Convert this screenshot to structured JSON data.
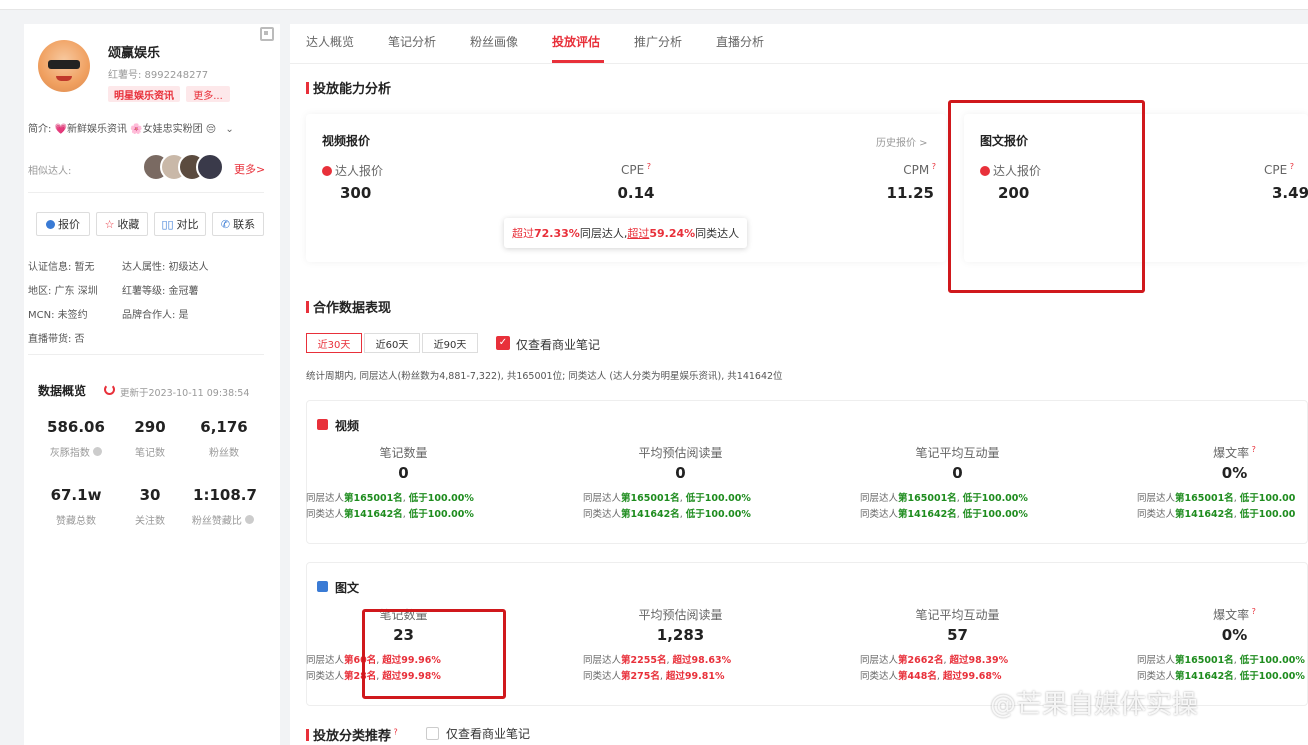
{
  "profile": {
    "name": "颂赢娱乐",
    "id_text": "红薯号: 8992248277",
    "tag": "明星娱乐资讯",
    "more_tag": "更多...",
    "bio": "简介: 💗新鲜娱乐资讯 🌸女娃忠实粉团 😔",
    "similar_label": "相似达人:",
    "similar_more": "更多>",
    "buttons": {
      "quote": "报价",
      "collect": "收藏",
      "compare": "对比",
      "contact": "联系"
    },
    "info": [
      {
        "left": "认证信息: 暂无",
        "right": "达人属性: 初级达人"
      },
      {
        "left": "地区: 广东 深圳",
        "right": "红薯等级: 金冠薯"
      },
      {
        "left": "MCN: 未签约",
        "right": "品牌合作人: 是"
      },
      {
        "left": "直播带货: 否",
        "right": ""
      }
    ]
  },
  "overview": {
    "title": "数据概览",
    "updated": "更新于2023-10-11 09:38:54",
    "stats": [
      {
        "value": "586.06",
        "label": "灰豚指数"
      },
      {
        "value": "290",
        "label": "笔记数"
      },
      {
        "value": "6,176",
        "label": "粉丝数"
      },
      {
        "value": "67.1w",
        "label": "赞藏总数"
      },
      {
        "value": "30",
        "label": "关注数"
      },
      {
        "value": "1:108.7",
        "label": "粉丝赞藏比"
      }
    ]
  },
  "tabs": [
    "达人概览",
    "笔记分析",
    "粉丝画像",
    "投放评估",
    "推广分析",
    "直播分析"
  ],
  "ability": {
    "title": "投放能力分析",
    "video": {
      "title": "视频报价",
      "history": "历史报价 >",
      "price_label": "达人报价",
      "price": "300",
      "cpe_label": "CPE",
      "cpe": "0.14",
      "cpm_label": "CPM",
      "cpm": "11.25"
    },
    "image": {
      "title": "图文报价",
      "price_label": "达人报价",
      "price": "200",
      "cpe_label": "CPE",
      "cpe": "3.49"
    },
    "tooltip": {
      "p1": "超过",
      "v1": "72.33%",
      "t1": "同层达人,",
      "p2": "超过",
      "v2": "59.24%",
      "t2": "同类达人"
    }
  },
  "coop": {
    "title": "合作数据表现",
    "ranges": [
      "近30天",
      "近60天",
      "近90天"
    ],
    "commercial_only": "仅查看商业笔记",
    "desc": "统计周期内, 同层达人(粉丝数为4,881-7,322), 共165001位; 同类达人 (达人分类为明星娱乐资讯), 共141642位"
  },
  "video_block": {
    "title": "视频",
    "cols": [
      {
        "label": "笔记数量",
        "value": "0",
        "l1": "同层达人第165001名, 低于100.00%",
        "l2": "同类达人第141642名, 低于100.00%"
      },
      {
        "label": "平均预估阅读量",
        "value": "0",
        "l1": "同层达人第165001名, 低于100.00%",
        "l2": "同类达人第141642名, 低于100.00%"
      },
      {
        "label": "笔记平均互动量",
        "value": "0",
        "l1": "同层达人第165001名, 低于100.00%",
        "l2": "同类达人第141642名, 低于100.00%"
      },
      {
        "label": "爆文率",
        "value": "0%",
        "l1": "同层达人第165001名, 低于100.00",
        "l2": "同类达人第141642名, 低于100.00"
      }
    ]
  },
  "image_block": {
    "title": "图文",
    "cols": [
      {
        "label": "笔记数量",
        "value": "23",
        "l1": "同层达人第60名, 超过99.96%",
        "l2": "同类达人第28名, 超过99.98%"
      },
      {
        "label": "平均预估阅读量",
        "value": "1,283",
        "l1": "同层达人第2255名, 超过98.63%",
        "l2": "同类达人第275名, 超过99.81%"
      },
      {
        "label": "笔记平均互动量",
        "value": "57",
        "l1": "同层达人第2662名, 超过98.39%",
        "l2": "同类达人第448名, 超过99.68%"
      },
      {
        "label": "爆文率",
        "value": "0%",
        "l1": "同层达人第165001名, 低于100.00%",
        "l2": "同类达人第141642名, 低于100.00%"
      }
    ]
  },
  "recommend": {
    "title": "投放分类推荐",
    "commercial_only": "仅查看商业笔记"
  },
  "watermark": "@芒果自媒体实操",
  "colors": {
    "accent": "#e8303a",
    "good": "#1e8c1e",
    "box": "#d0181c"
  }
}
